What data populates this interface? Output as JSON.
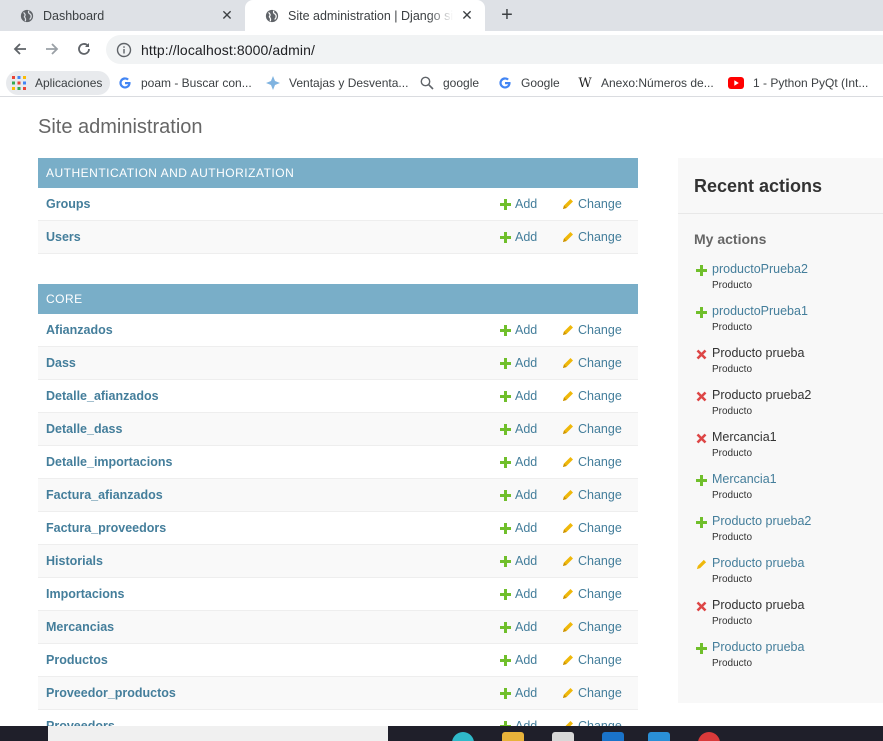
{
  "browser": {
    "tabs": [
      {
        "title": "Dashboard",
        "active": false
      },
      {
        "title": "Site administration | Django site admin",
        "active": true
      }
    ],
    "url": "http://localhost:8000/admin/",
    "bookmarks": [
      {
        "label": "Aplicaciones",
        "icon": "apps-grid-icon"
      },
      {
        "label": "poam - Buscar con...",
        "icon": "google-icon"
      },
      {
        "label": "Ventajas y Desventa...",
        "icon": "globe-icon"
      },
      {
        "label": "google",
        "icon": "search-icon"
      },
      {
        "label": "Google",
        "icon": "google-icon"
      },
      {
        "label": "Anexo:Números de...",
        "icon": "wikipedia-icon"
      },
      {
        "label": "1 - Python PyQt (Int...",
        "icon": "youtube-icon"
      }
    ]
  },
  "page": {
    "site_title": "Site administration",
    "add_label": "Add",
    "change_label": "Change",
    "modules": [
      {
        "caption": "Authentication and Authorization",
        "models": [
          "Groups",
          "Users"
        ]
      },
      {
        "caption": "Core",
        "models": [
          "Afianzados",
          "Dass",
          "Detalle_afianzados",
          "Detalle_dass",
          "Detalle_importacions",
          "Factura_afianzados",
          "Factura_proveedors",
          "Historials",
          "Importacions",
          "Mercancias",
          "Productos",
          "Proveedor_productos",
          "Proveedors"
        ]
      }
    ],
    "recent": {
      "title": "Recent actions",
      "my_actions": "My actions",
      "items": [
        {
          "action": "addition",
          "name": "productoPrueba2",
          "type": "Producto",
          "link": true
        },
        {
          "action": "addition",
          "name": "productoPrueba1",
          "type": "Producto",
          "link": true
        },
        {
          "action": "deletion",
          "name": "Producto prueba",
          "type": "Producto",
          "link": false
        },
        {
          "action": "deletion",
          "name": "Producto prueba2",
          "type": "Producto",
          "link": false
        },
        {
          "action": "deletion",
          "name": "Mercancia1",
          "type": "Producto",
          "link": false
        },
        {
          "action": "addition",
          "name": "Mercancia1",
          "type": "Producto",
          "link": true
        },
        {
          "action": "addition",
          "name": "Producto prueba2",
          "type": "Producto",
          "link": true
        },
        {
          "action": "change",
          "name": "Producto prueba",
          "type": "Producto",
          "link": true
        },
        {
          "action": "deletion",
          "name": "Producto prueba",
          "type": "Producto",
          "link": false
        },
        {
          "action": "addition",
          "name": "Producto prueba",
          "type": "Producto",
          "link": true
        }
      ]
    }
  },
  "colors": {
    "module_header": "#79aec8",
    "link": "#447e9b",
    "add_green": "#70bf2b",
    "delete_red": "#dd4646",
    "change_yellow": "#efb80b"
  }
}
